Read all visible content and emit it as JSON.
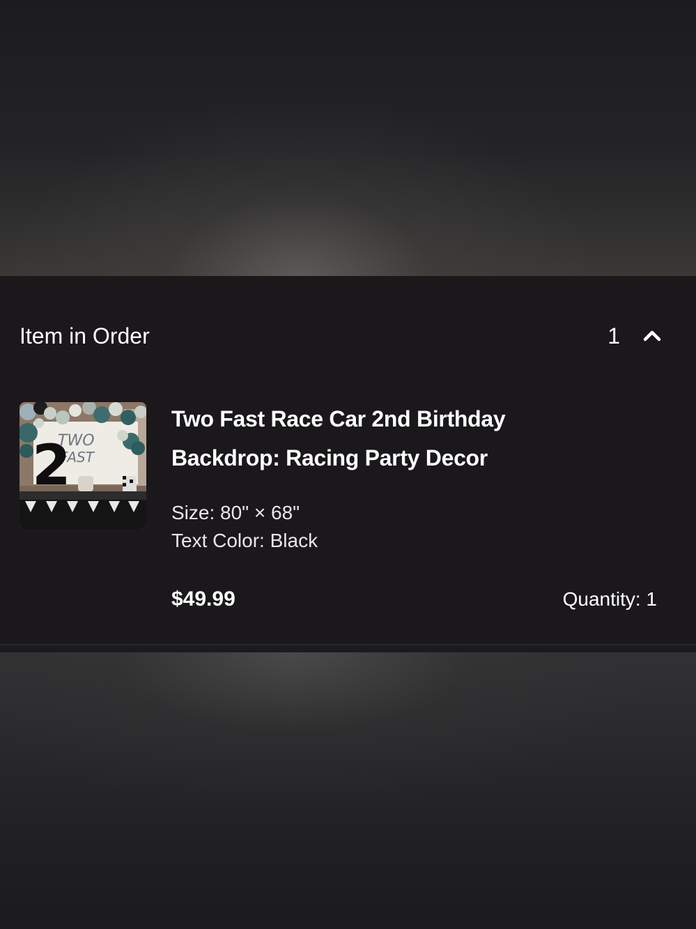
{
  "order_section": {
    "heading": "Item in Order",
    "item_count": "1",
    "toggle_icon": "chevron-up-icon"
  },
  "item": {
    "title_line_1": "Two Fast Race Car 2nd Birthday",
    "title_line_2": "Backdrop: Racing Party Decor",
    "variations": [
      "Size: 80\" × 68\"",
      "Text Color: Black"
    ],
    "price": "$49.99",
    "quantity_text": "Quantity: 1",
    "thumbnail": {
      "banner_text_1": "TWO",
      "banner_text_2": "FAST",
      "number": "2"
    }
  },
  "colors": {
    "panel_background": "#1b181c",
    "text_primary": "#ffffff"
  }
}
